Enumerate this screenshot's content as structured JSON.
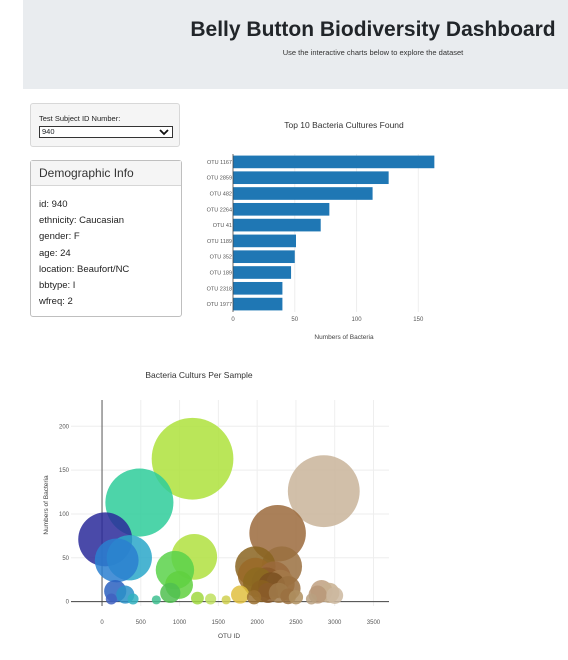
{
  "header": {
    "title": "Belly Button Biodiversity Dashboard",
    "subtitle": "Use the interactive charts below to explore the dataset"
  },
  "selector": {
    "label": "Test Subject ID Number:",
    "selected": "940"
  },
  "demographics": {
    "title": "Demographic Info",
    "rows": [
      "id: 940",
      "ethnicity: Caucasian",
      "gender: F",
      "age: 24",
      "location: Beaufort/NC",
      "bbtype: I",
      "wfreq: 2"
    ]
  },
  "chart_data": [
    {
      "type": "bar",
      "orientation": "horizontal",
      "title": "Top 10 Bacteria Cultures Found",
      "xlabel": "Numbers of Bacteria",
      "ylabel": "",
      "categories": [
        "OTU 1167",
        "OTU 2859",
        "OTU 482",
        "OTU 2264",
        "OTU 41",
        "OTU 1189",
        "OTU 352",
        "OTU 189",
        "OTU 2318",
        "OTU 1977"
      ],
      "values": [
        163,
        126,
        113,
        78,
        71,
        51,
        50,
        47,
        40,
        40
      ],
      "xlim": [
        0,
        170
      ],
      "xticks": [
        0,
        50,
        100,
        150
      ],
      "color": "#1f77b4"
    },
    {
      "type": "scatter",
      "subtype": "bubble",
      "title": "Bacteria Culturs Per Sample",
      "xlabel": "OTU ID",
      "ylabel": "Numbers of Bacteria",
      "xlim": [
        -400,
        3700
      ],
      "ylim": [
        -5,
        230
      ],
      "xticks": [
        0,
        500,
        1000,
        1500,
        2000,
        2500,
        3000,
        3500
      ],
      "yticks": [
        0,
        50,
        100,
        150,
        200
      ],
      "points": [
        {
          "x": 1167,
          "y": 163,
          "color": "#aee23c"
        },
        {
          "x": 2859,
          "y": 126,
          "color": "#c9b49a"
        },
        {
          "x": 482,
          "y": 113,
          "color": "#2ecc9a"
        },
        {
          "x": 2264,
          "y": 78,
          "color": "#9b6a3c"
        },
        {
          "x": 41,
          "y": 71,
          "color": "#2a2a9a"
        },
        {
          "x": 1189,
          "y": 51,
          "color": "#b0e040"
        },
        {
          "x": 352,
          "y": 50,
          "color": "#2aa7c9"
        },
        {
          "x": 189,
          "y": 47,
          "color": "#2a7fd0"
        },
        {
          "x": 2318,
          "y": 40,
          "color": "#9a7040"
        },
        {
          "x": 1977,
          "y": 40,
          "color": "#8a6420"
        },
        {
          "x": 1977,
          "y": 30,
          "color": "#9a6a28"
        },
        {
          "x": 940,
          "y": 36,
          "color": "#5ad24a"
        },
        {
          "x": 2220,
          "y": 27,
          "color": "#9b6a3c"
        },
        {
          "x": 2122,
          "y": 22,
          "color": "#8c5a2a"
        },
        {
          "x": 2300,
          "y": 20,
          "color": "#a57a4a"
        },
        {
          "x": 2011,
          "y": 22,
          "color": "#8c6a20"
        },
        {
          "x": 2187,
          "y": 18,
          "color": "#7a5020"
        },
        {
          "x": 993,
          "y": 19,
          "color": "#60d040"
        },
        {
          "x": 2400,
          "y": 15,
          "color": "#9a7040"
        },
        {
          "x": 2060,
          "y": 12,
          "color": "#8a6020"
        },
        {
          "x": 2140,
          "y": 10,
          "color": "#8a5a2a"
        },
        {
          "x": 2280,
          "y": 10,
          "color": "#a07a4a"
        },
        {
          "x": 2400,
          "y": 6,
          "color": "#9a7040"
        },
        {
          "x": 2930,
          "y": 10,
          "color": "#c8b090"
        },
        {
          "x": 2830,
          "y": 12,
          "color": "#c0a080"
        },
        {
          "x": 2780,
          "y": 8,
          "color": "#b89878"
        },
        {
          "x": 170,
          "y": 12,
          "color": "#2a60c0"
        },
        {
          "x": 300,
          "y": 8,
          "color": "#2a90c8"
        },
        {
          "x": 880,
          "y": 10,
          "color": "#50c050"
        },
        {
          "x": 1780,
          "y": 8,
          "color": "#e0c040"
        },
        {
          "x": 1960,
          "y": 5,
          "color": "#9a7030"
        },
        {
          "x": 2500,
          "y": 5,
          "color": "#b09060"
        },
        {
          "x": 3000,
          "y": 7,
          "color": "#ccb8a0"
        },
        {
          "x": 1230,
          "y": 4,
          "color": "#a0d840"
        },
        {
          "x": 1400,
          "y": 3,
          "color": "#c0e060"
        },
        {
          "x": 120,
          "y": 3,
          "color": "#4060c0"
        },
        {
          "x": 400,
          "y": 3,
          "color": "#30b0c0"
        },
        {
          "x": 2700,
          "y": 3,
          "color": "#b8a080"
        },
        {
          "x": 1600,
          "y": 2,
          "color": "#d0d050"
        },
        {
          "x": 700,
          "y": 2,
          "color": "#40c090"
        }
      ]
    }
  ]
}
